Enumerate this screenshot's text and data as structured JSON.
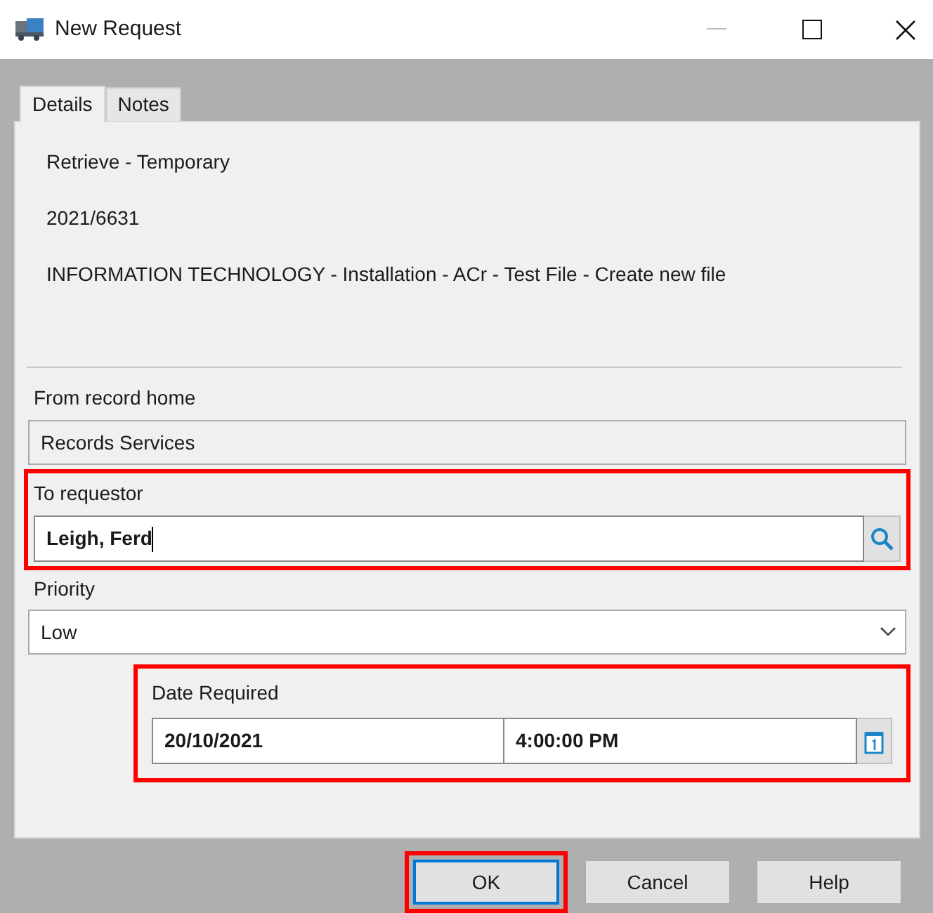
{
  "window": {
    "title": "New Request"
  },
  "tabs": [
    {
      "label": "Details",
      "selected": true
    },
    {
      "label": "Notes",
      "selected": false
    }
  ],
  "summary": [
    "Retrieve - Temporary",
    "2021/6631",
    "INFORMATION TECHNOLOGY - Installation - ACr - Test File - Create new file"
  ],
  "from_record_home": {
    "label": "From record home",
    "value": "Records Services",
    "highlighted": false
  },
  "to_requestor": {
    "label": "To requestor",
    "value": "Leigh, Ferd",
    "highlighted": true
  },
  "priority": {
    "label": "Priority",
    "value": "Low",
    "highlighted": false
  },
  "date_required": {
    "label": "Date Required",
    "date": "20/10/2021",
    "time": "4:00:00 PM",
    "highlighted": true
  },
  "buttons": [
    {
      "label": "OK",
      "highlighted": true,
      "default": true
    },
    {
      "label": "Cancel",
      "highlighted": false,
      "default": false
    },
    {
      "label": "Help",
      "highlighted": false,
      "default": false
    }
  ]
}
